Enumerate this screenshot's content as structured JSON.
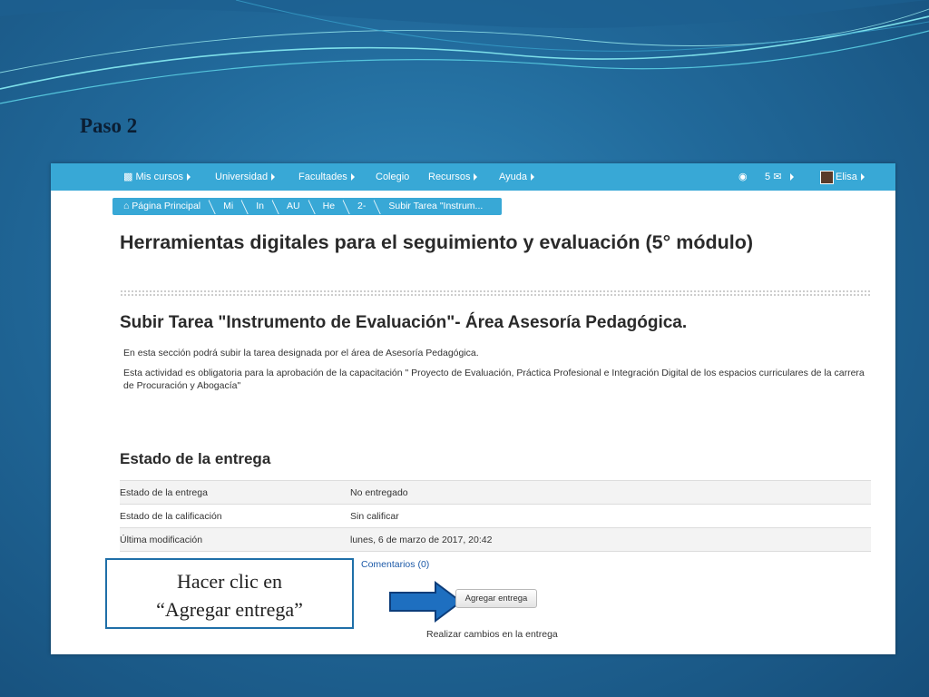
{
  "slide": {
    "title": "Paso 2"
  },
  "navbar": {
    "items": [
      "Mis cursos",
      "Universidad",
      "Facultades",
      "Colegio",
      "Recursos",
      "Ayuda"
    ],
    "message_count": "5",
    "user": "Elisa"
  },
  "breadcrumb": [
    "Página Principal",
    "Mi",
    "In",
    "AU",
    "He",
    "2-",
    "Subir Tarea \"Instrum..."
  ],
  "course": {
    "title": "Herramientas digitales para el seguimiento y evaluación (5° módulo)"
  },
  "assignment": {
    "title": "Subir Tarea \"Instrumento de Evaluación\"- Área Asesoría Pedagógica.",
    "desc1": "En esta sección podrá subir la tarea designada por el área de Asesoría Pedagógica.",
    "desc2": "Esta actividad es obligatoria para la aprobación de la capacitación \" Proyecto de Evaluación, Práctica Profesional e Integración Digital de los espacios curriculares de la carrera de Procuración y Abogacía\""
  },
  "submission": {
    "heading": "Estado de la entrega",
    "rows": [
      {
        "label": "Estado de la entrega",
        "value": "No entregado"
      },
      {
        "label": "Estado de la calificación",
        "value": "Sin calificar"
      },
      {
        "label": "Última modificación",
        "value": "lunes, 6 de marzo de 2017, 20:42"
      }
    ],
    "comments": "Comentarios (0)",
    "add_button": "Agregar entrega",
    "changes_text": "Realizar cambios en la entrega"
  },
  "callout": {
    "line1": "Hacer clic en",
    "line2": "“Agregar entrega”"
  },
  "colors": {
    "navbar": "#38a8d6",
    "slide_bg": "#21699a",
    "arrow": "#1e6fc0"
  }
}
